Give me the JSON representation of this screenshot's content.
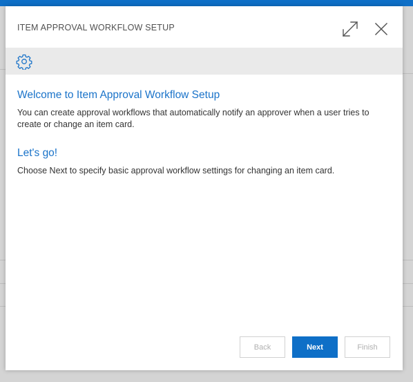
{
  "dialog": {
    "title": "ITEM APPROVAL WORKFLOW SETUP",
    "icons": {
      "expand": "expand-icon",
      "close": "close-icon",
      "settings": "gear-icon"
    }
  },
  "content": {
    "welcome_heading": "Welcome to Item Approval Workflow Setup",
    "welcome_text": "You can create approval workflows that automatically notify an approver when a user tries to create or change an item card.",
    "letsgo_heading": "Let's go!",
    "letsgo_text": "Choose Next to specify basic approval workflow settings for changing an item card."
  },
  "footer": {
    "back_label": "Back",
    "next_label": "Next",
    "finish_label": "Finish"
  },
  "colors": {
    "accent": "#0e6fc7",
    "heading": "#1a73c9",
    "toolbar_bg": "#eaeaea"
  }
}
